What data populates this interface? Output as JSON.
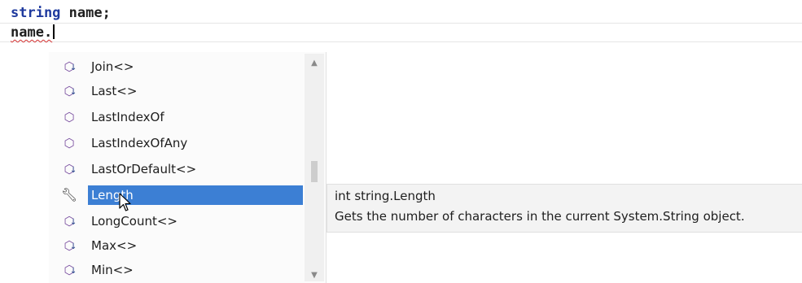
{
  "editor": {
    "line1_keyword": "string",
    "line1_rest": " name;",
    "line2_text": "name."
  },
  "completion": {
    "items": [
      {
        "label": "Join<>",
        "icon": "extension-method-icon"
      },
      {
        "label": "Last<>",
        "icon": "extension-method-icon"
      },
      {
        "label": "LastIndexOf",
        "icon": "method-icon"
      },
      {
        "label": "LastIndexOfAny",
        "icon": "method-icon"
      },
      {
        "label": "LastOrDefault<>",
        "icon": "extension-method-icon"
      },
      {
        "label": "Length",
        "icon": "wrench-icon",
        "selected": true
      },
      {
        "label": "LongCount<>",
        "icon": "extension-method-icon"
      },
      {
        "label": "Max<>",
        "icon": "extension-method-icon"
      },
      {
        "label": "Min<>",
        "icon": "extension-method-icon"
      }
    ]
  },
  "tooltip": {
    "signature": "int string.Length",
    "description": "Gets the number of characters in the current System.String object."
  },
  "colors": {
    "keyword": "#1f3a9e",
    "selection": "#3c7fd4",
    "method_icon": "#7a4fa0"
  }
}
